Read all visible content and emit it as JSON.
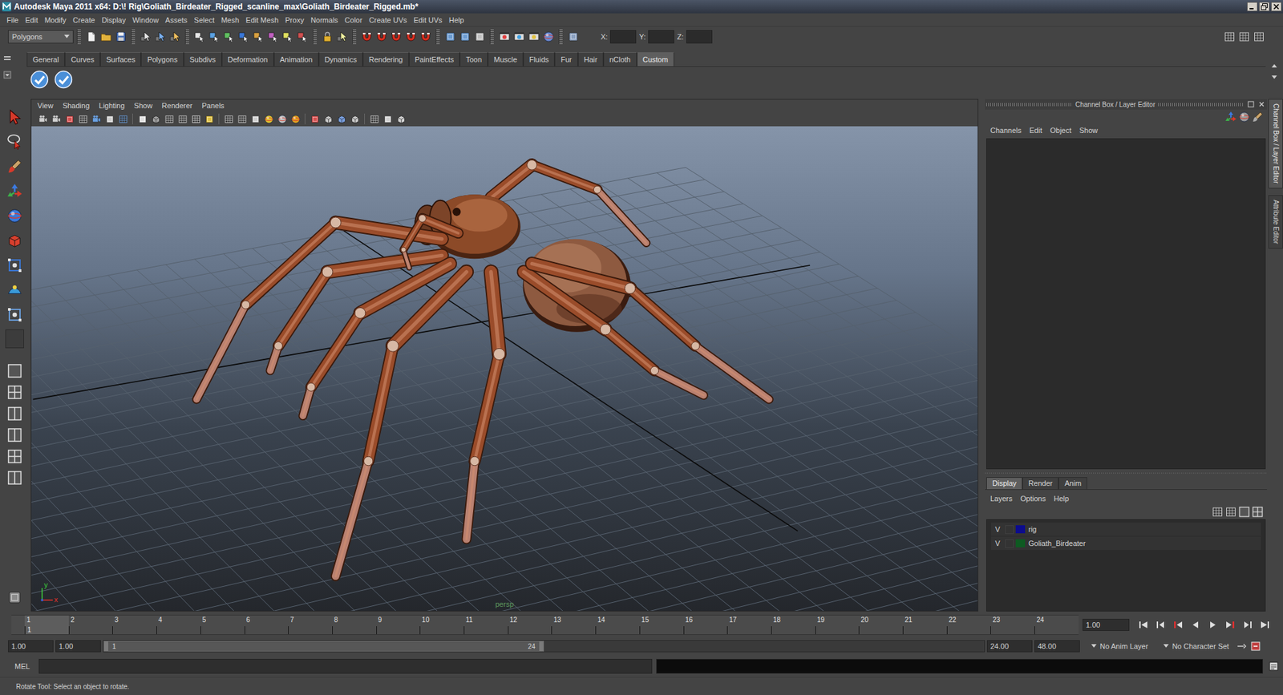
{
  "window": {
    "title": "Autodesk Maya 2011 x64: D:\\! Rig\\Goliath_Birdeater_Rigged_scanline_max\\Goliath_Birdeater_Rigged.mb*"
  },
  "menubar": [
    "File",
    "Edit",
    "Modify",
    "Create",
    "Display",
    "Window",
    "Assets",
    "Select",
    "Mesh",
    "Edit Mesh",
    "Proxy",
    "Normals",
    "Color",
    "Create UVs",
    "Edit UVs",
    "Help"
  ],
  "status_line": {
    "mode": "Polygons",
    "fields": [
      {
        "label": "X:"
      },
      {
        "label": "Y:"
      },
      {
        "label": "Z:"
      }
    ]
  },
  "shelf": {
    "tabs": [
      {
        "label": "General",
        "selected": false
      },
      {
        "label": "Curves",
        "selected": false
      },
      {
        "label": "Surfaces",
        "selected": false
      },
      {
        "label": "Polygons",
        "selected": false
      },
      {
        "label": "Subdivs",
        "selected": false
      },
      {
        "label": "Deformation",
        "selected": false
      },
      {
        "label": "Animation",
        "selected": false
      },
      {
        "label": "Dynamics",
        "selected": false
      },
      {
        "label": "Rendering",
        "selected": false
      },
      {
        "label": "PaintEffects",
        "selected": false
      },
      {
        "label": "Toon",
        "selected": false
      },
      {
        "label": "Muscle",
        "selected": false
      },
      {
        "label": "Fluids",
        "selected": false
      },
      {
        "label": "Fur",
        "selected": false
      },
      {
        "label": "Hair",
        "selected": false
      },
      {
        "label": "nCloth",
        "selected": false
      },
      {
        "label": "Custom",
        "selected": true
      }
    ]
  },
  "viewport": {
    "menu": [
      "View",
      "Shading",
      "Lighting",
      "Show",
      "Renderer",
      "Panels"
    ],
    "camera": "persp",
    "axis": [
      {
        "label": "y",
        "color": "#3ccf3c"
      },
      {
        "label": "x",
        "color": "#e0302a"
      }
    ]
  },
  "channel_box": {
    "title": "Channel Box / Layer Editor",
    "menu": [
      "Channels",
      "Edit",
      "Object",
      "Show"
    ]
  },
  "side_tabs": [
    {
      "label": "Channel Box / Layer Editor",
      "selected": true
    },
    {
      "label": "Attribute Editor",
      "selected": false
    }
  ],
  "layer_editor": {
    "tabs": [
      {
        "label": "Display",
        "selected": true
      },
      {
        "label": "Render",
        "selected": false
      },
      {
        "label": "Anim",
        "selected": false
      }
    ],
    "menu": [
      "Layers",
      "Options",
      "Help"
    ],
    "layers": [
      {
        "visibility": "V",
        "name": "rig",
        "color": "#0c0c8c"
      },
      {
        "visibility": "V",
        "name": "Goliath_Birdeater",
        "color": "#0e5a22"
      }
    ]
  },
  "time_slider": {
    "ticks": [
      "1",
      "2",
      "3",
      "4",
      "5",
      "6",
      "7",
      "8",
      "9",
      "10",
      "11",
      "12",
      "13",
      "14",
      "15",
      "16",
      "17",
      "18",
      "19",
      "20",
      "21",
      "22",
      "23",
      "24"
    ],
    "current": "1",
    "current_field": "1.00"
  },
  "range_slider": {
    "start": "1.00",
    "playback_start": "1.00",
    "range_start": "1",
    "range_end": "24",
    "playback_end": "24.00",
    "end": "48.00",
    "level": 0.5
  },
  "anim_layer": "No Anim Layer",
  "character_set": "No Character Set",
  "command_line": {
    "language": "MEL"
  },
  "help_line": "Rotate Tool: Select an object to rotate."
}
